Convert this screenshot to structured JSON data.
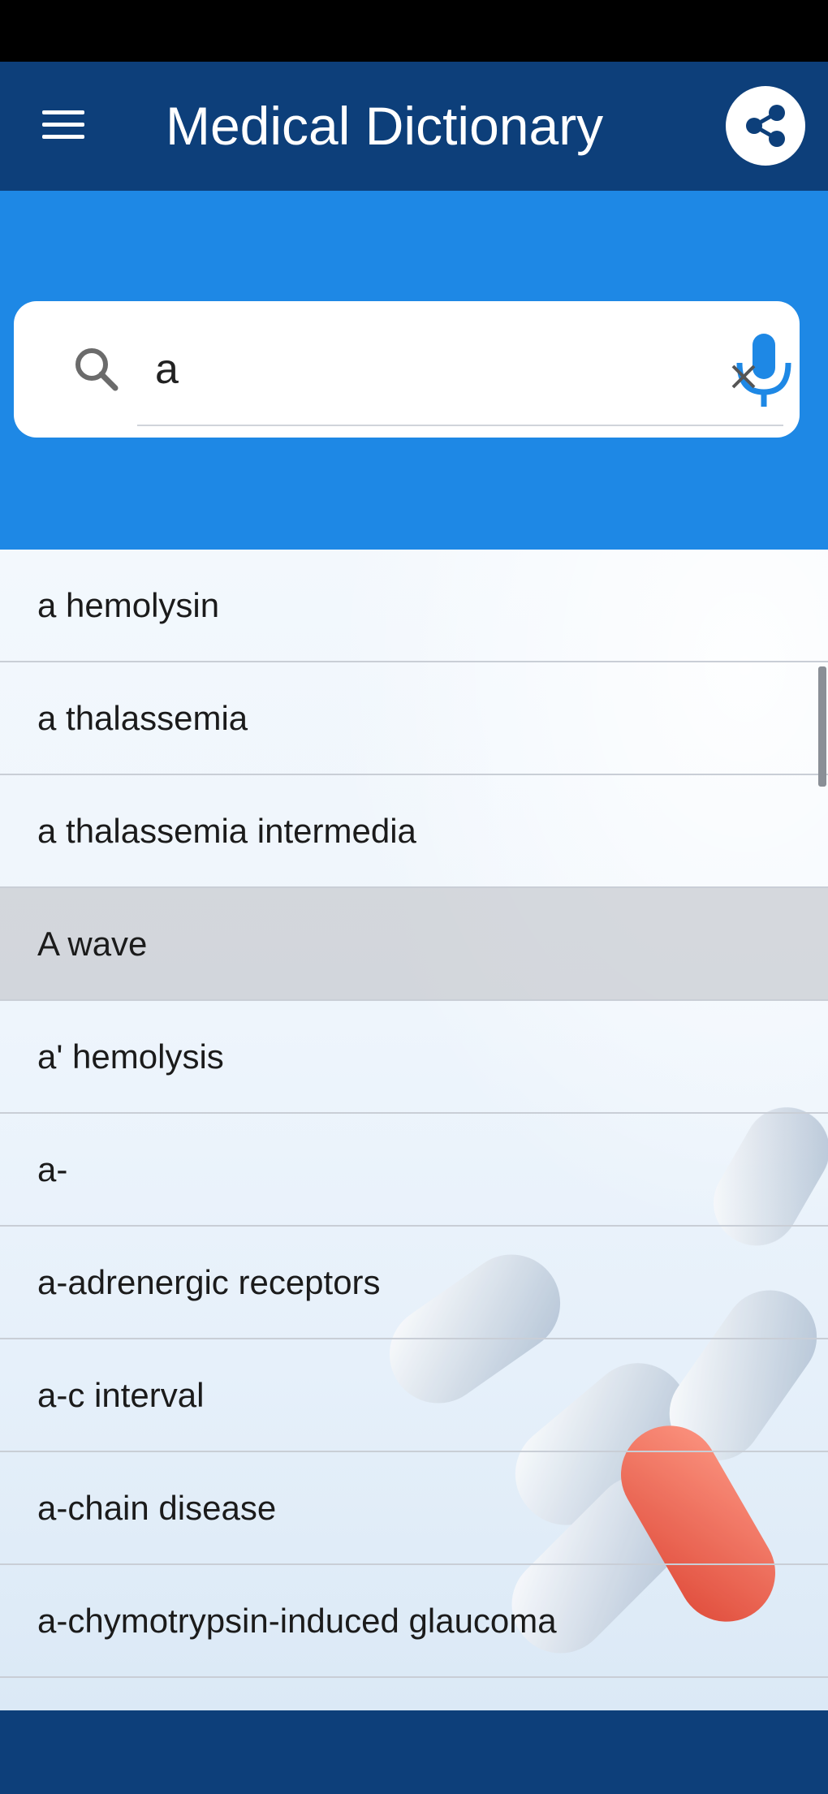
{
  "app_bar": {
    "title": "Medical Dictionary",
    "menu_icon": "hamburger-menu-icon",
    "share_icon": "share-icon",
    "color": "#0d3f7a"
  },
  "search": {
    "value": "a",
    "placeholder": "",
    "search_icon": "search-icon",
    "mic_icon": "microphone-icon",
    "accent": "#1e88e5"
  },
  "results": {
    "items": [
      {
        "label": "a hemolysin"
      },
      {
        "label": "a thalassemia"
      },
      {
        "label": "a thalassemia intermedia"
      },
      {
        "label": "A wave",
        "selected": true
      },
      {
        "label": "a' hemolysis"
      },
      {
        "label": "a-"
      },
      {
        "label": "a-adrenergic receptors"
      },
      {
        "label": "a-c interval"
      },
      {
        "label": "a-chain disease"
      },
      {
        "label": "a-chymotrypsin-induced glaucoma"
      }
    ]
  },
  "colors": {
    "status_bar": "#000000",
    "app_bar": "#0d3f7a",
    "search_band": "#1e88e5",
    "bottom_bar": "#0d3f7a",
    "accent_pill": "#e8503a"
  }
}
